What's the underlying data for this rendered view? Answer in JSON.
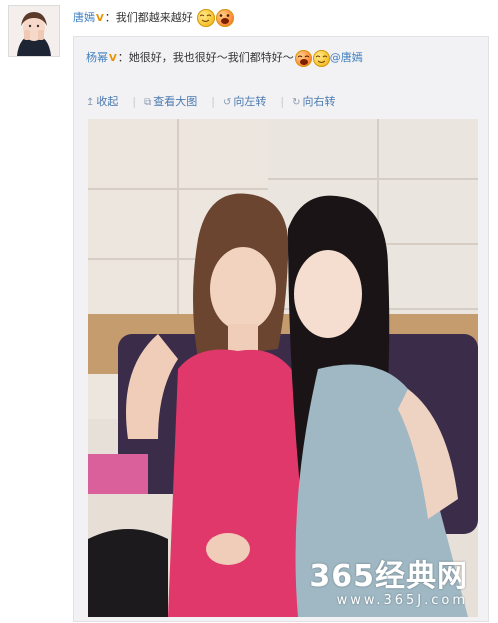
{
  "post": {
    "author": "唐嫣",
    "badge": "V",
    "separator": "：",
    "text": "我们都越来越好",
    "emojis": [
      "smile-emoji",
      "surprised-emoji"
    ]
  },
  "repost": {
    "author": "杨幂",
    "badge": "V",
    "separator": "：",
    "text": "她很好，我也很好～我们都特好～",
    "emojis": [
      "laughing-emoji",
      "smile-emoji"
    ],
    "mention": "@唐嫣"
  },
  "actions": [
    {
      "icon": "collapse-icon",
      "label": "收起"
    },
    {
      "icon": "view-large-icon",
      "label": "查看大图"
    },
    {
      "icon": "rotate-left-icon",
      "label": "向左转"
    },
    {
      "icon": "rotate-right-icon",
      "label": "向右转"
    }
  ],
  "watermark": {
    "main": "365经典网",
    "sub": "www.365J.com"
  },
  "colors": {
    "link": "#3f7fbf",
    "badge": "#e89200",
    "panel": "#f2f2f5"
  }
}
